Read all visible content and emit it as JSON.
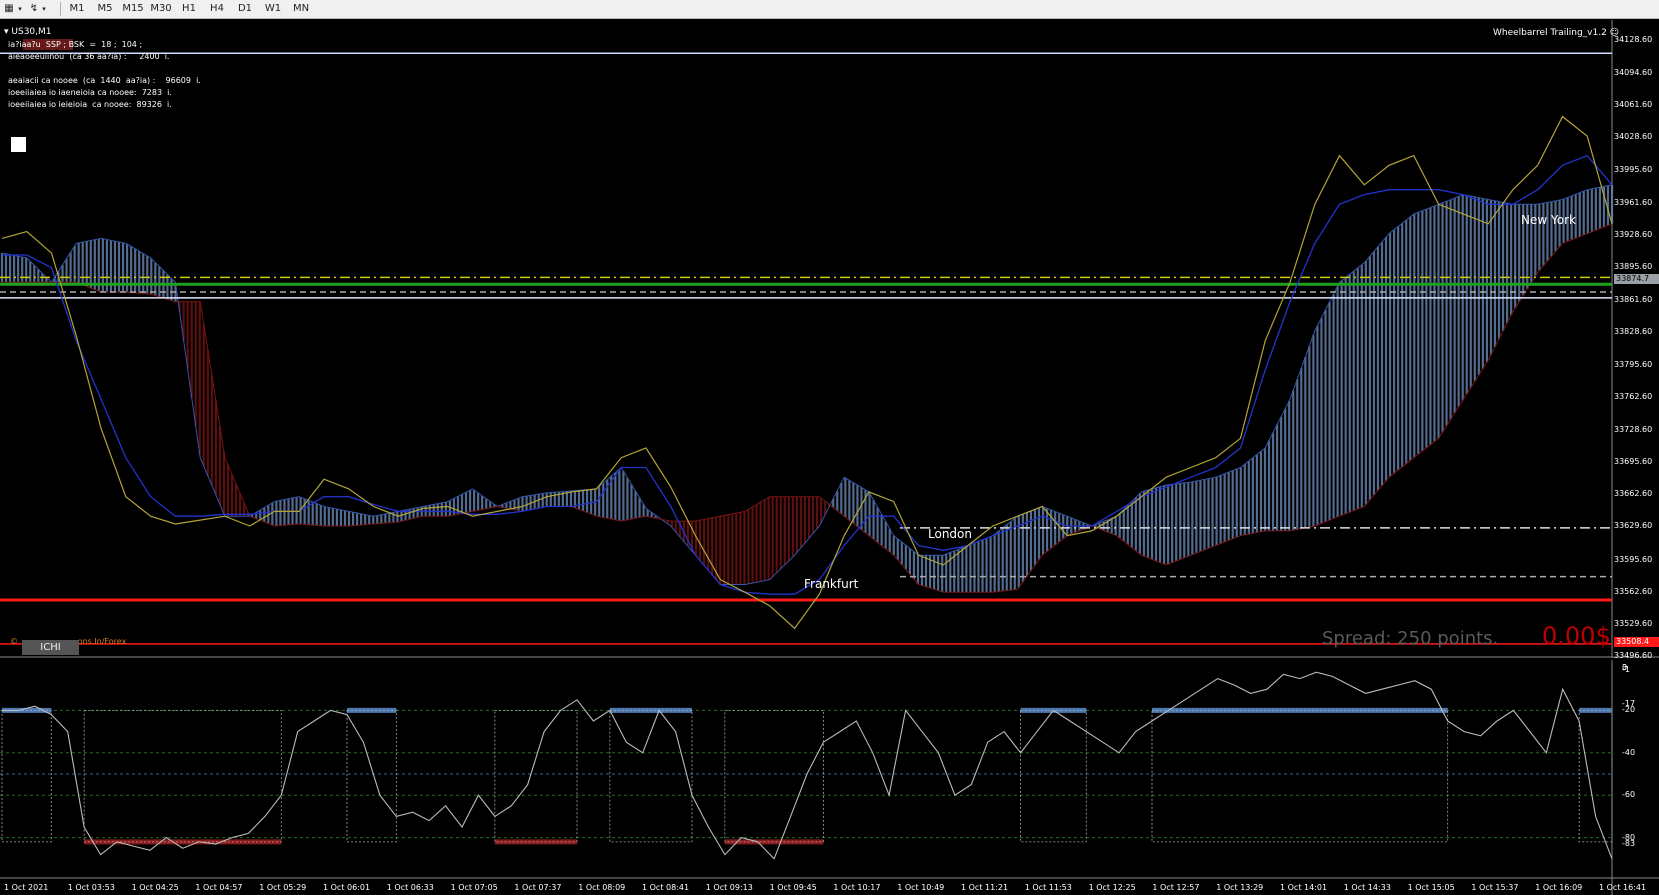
{
  "toolbar": {
    "timeframes": [
      "M1",
      "M5",
      "M15",
      "M30",
      "H1",
      "H4",
      "D1",
      "W1",
      "MN"
    ]
  },
  "chart_header": {
    "symbol": "US30,M1",
    "ea_name": "Wheelbarrel Trailing_v1.2"
  },
  "info_lines": [
    "ia?iaa?u  SSP ; BSK  =  18 ;  104 ;",
    "aieaoeeuiinou  (ca 36 aa?ia) :     2400  i.",
    "aeaiacii ca nooee  (ca  1440  aa?ia) :    96609  i.",
    "ioeeiiaiea io iaeneioia ca nooee:  7283  i.",
    "ioeeiiaiea io ieieioia  ca nooee:  89326  i."
  ],
  "sessions": {
    "new_york": "New York",
    "london": "London",
    "frankfurt": "Frankfurt"
  },
  "spread_text": "Spread: 250 points.",
  "profit_text": "0.00$",
  "ichi_button": "ICHI",
  "copyright_symbol": "©",
  "copyright_text": "...ons.In/Forex",
  "current_price": "33874.7",
  "low_price_tag": "33508.4",
  "colors": {
    "background": "#000000",
    "cloud_bull": "#6f8fbf",
    "cloud_bear": "#7a1414",
    "price_line": "#b2a438",
    "kijun": "#2233cc",
    "support_red": "#ff1a1a",
    "green_level": "#1fa31f",
    "yellow_level": "#cccc00",
    "white_level": "#e0e6ff",
    "osc_bull": "#4d79b3",
    "osc_bear": "#8b1a1a"
  },
  "chart_data": [
    {
      "type": "line",
      "name": "US30,M1 Ichimoku",
      "x": [
        "1 Oct 2021",
        "1 Oct 03:53",
        "1 Oct 04:25",
        "1 Oct 04:57",
        "1 Oct 05:29",
        "1 Oct 06:01",
        "1 Oct 06:33",
        "1 Oct 07:05",
        "1 Oct 07:37",
        "1 Oct 08:09",
        "1 Oct 08:41",
        "1 Oct 09:13",
        "1 Oct 09:45",
        "1 Oct 10:17",
        "1 Oct 10:49",
        "1 Oct 11:21",
        "1 Oct 11:53",
        "1 Oct 12:25",
        "1 Oct 12:57",
        "1 Oct 13:29",
        "1 Oct 14:01",
        "1 Oct 14:33",
        "1 Oct 15:05",
        "1 Oct 15:37",
        "1 Oct 16:09",
        "1 Oct 16:41"
      ],
      "y_ticks": [
        "34128.60",
        "34094.60",
        "34061.60",
        "34028.60",
        "33995.60",
        "33961.60",
        "33928.60",
        "33895.60",
        "33861.60",
        "33828.60",
        "33795.60",
        "33762.60",
        "33728.60",
        "33695.60",
        "33662.60",
        "33629.60",
        "33595.60",
        "33562.60",
        "33529.60",
        "33496.60"
      ],
      "ylim": [
        33496.6,
        34128.6
      ],
      "price": [
        33925,
        33932,
        33910,
        33825,
        33730,
        33660,
        33640,
        33632,
        33636,
        33640,
        33630,
        33645,
        33645,
        33678,
        33668,
        33650,
        33640,
        33648,
        33650,
        33640,
        33645,
        33650,
        33660,
        33665,
        33668,
        33700,
        33710,
        33670,
        33620,
        33575,
        33562,
        33548,
        33525,
        33560,
        33620,
        33665,
        33655,
        33600,
        33590,
        33610,
        33630,
        33640,
        33650,
        33620,
        33625,
        33640,
        33660,
        33680,
        33690,
        33700,
        33720,
        33820,
        33880,
        33960,
        34010,
        33980,
        34000,
        34010,
        33960,
        33950,
        33940,
        33975,
        34000,
        34050,
        34030,
        33940
      ],
      "kijun": [
        33908,
        33908,
        33895,
        33820,
        33760,
        33700,
        33660,
        33640,
        33640,
        33642,
        33642,
        33645,
        33645,
        33660,
        33660,
        33652,
        33645,
        33645,
        33645,
        33642,
        33642,
        33645,
        33650,
        33650,
        33655,
        33690,
        33690,
        33650,
        33600,
        33570,
        33562,
        33560,
        33560,
        33575,
        33610,
        33640,
        33640,
        33610,
        33605,
        33610,
        33620,
        33630,
        33640,
        33630,
        33630,
        33645,
        33660,
        33670,
        33680,
        33690,
        33710,
        33790,
        33860,
        33920,
        33960,
        33970,
        33975,
        33975,
        33975,
        33970,
        33960,
        33960,
        33975,
        34000,
        34010,
        33980
      ],
      "span_a": [
        33910,
        33905,
        33880,
        33920,
        33925,
        33920,
        33905,
        33880,
        33700,
        33640,
        33640,
        33655,
        33660,
        33650,
        33645,
        33640,
        33645,
        33650,
        33655,
        33668,
        33650,
        33660,
        33664,
        33666,
        33668,
        33690,
        33648,
        33630,
        33600,
        33570,
        33570,
        33575,
        33600,
        33630,
        33680,
        33665,
        33620,
        33600,
        33600,
        33610,
        33620,
        33640,
        33650,
        33640,
        33630,
        33640,
        33665,
        33672,
        33675,
        33680,
        33690,
        33710,
        33760,
        33830,
        33880,
        33900,
        33930,
        33950,
        33960,
        33970,
        33965,
        33960,
        33960,
        33965,
        33975,
        33980
      ],
      "span_b": [
        33880,
        33880,
        33880,
        33880,
        33870,
        33870,
        33868,
        33860,
        33860,
        33700,
        33640,
        33630,
        33632,
        33630,
        33630,
        33632,
        33634,
        33640,
        33640,
        33645,
        33650,
        33645,
        33650,
        33650,
        33640,
        33635,
        33640,
        33635,
        33635,
        33640,
        33645,
        33660,
        33660,
        33660,
        33640,
        33620,
        33600,
        33570,
        33562,
        33562,
        33562,
        33565,
        33600,
        33620,
        33630,
        33620,
        33600,
        33590,
        33600,
        33610,
        33620,
        33625,
        33625,
        33630,
        33640,
        33650,
        33680,
        33700,
        33720,
        33760,
        33800,
        33850,
        33890,
        33920,
        33930,
        33940
      ],
      "levels": [
        {
          "name": "yellow-dashdot",
          "value": 33885,
          "color": "#cccc00"
        },
        {
          "name": "green",
          "value": 33878,
          "color": "#1fa31f"
        },
        {
          "name": "gray-dashed",
          "value": 33870,
          "color": "#aaaaaa"
        },
        {
          "name": "light-blue",
          "value": 33864,
          "color": "#e0e6ff"
        },
        {
          "name": "top-blue",
          "value": 34115,
          "color": "#cfe0ff"
        },
        {
          "name": "white-dashdot-right",
          "value": 33628,
          "color": "#dddddd"
        },
        {
          "name": "gray-dashed-right",
          "value": 33578,
          "color": "#aaaaaa"
        },
        {
          "name": "red-support",
          "value": 33554,
          "color": "#ff1a1a"
        },
        {
          "name": "red-thin-bottom",
          "value": 33509,
          "color": "#ff1a1a"
        }
      ]
    },
    {
      "type": "line",
      "name": "Oscillator",
      "y_ticks": [
        "3",
        "-17",
        "-20",
        "-40",
        "0",
        "-60",
        "-80",
        "-83",
        "-1"
      ],
      "ylim": [
        -100,
        0
      ],
      "values": [
        -20,
        -20,
        -18,
        -22,
        -30,
        -75,
        -88,
        -82,
        -84,
        -86,
        -80,
        -85,
        -82,
        -83,
        -80,
        -78,
        -70,
        -60,
        -30,
        -25,
        -20,
        -22,
        -35,
        -60,
        -70,
        -68,
        -72,
        -65,
        -75,
        -60,
        -70,
        -65,
        -55,
        -30,
        -20,
        -15,
        -25,
        -20,
        -35,
        -40,
        -20,
        -30,
        -60,
        -75,
        -88,
        -80,
        -82,
        -90,
        -70,
        -50,
        -35,
        -30,
        -25,
        -40,
        -60,
        -20,
        -30,
        -40,
        -60,
        -55,
        -35,
        -30,
        -40,
        -30,
        -20,
        -25,
        -30,
        -35,
        -40,
        -30,
        -25,
        -20,
        -15,
        -10,
        -5,
        -8,
        -12,
        -10,
        -3,
        -5,
        -2,
        -4,
        -8,
        -12,
        -10,
        -8,
        -6,
        -10,
        -25,
        -30,
        -32,
        -25,
        -20,
        -30,
        -40,
        -10,
        -25,
        -70,
        -90
      ],
      "signal_segments": [
        {
          "from": 0,
          "to": 3,
          "state": "bull"
        },
        {
          "from": 5,
          "to": 17,
          "state": "bear"
        },
        {
          "from": 21,
          "to": 24,
          "state": "bull"
        },
        {
          "from": 30,
          "to": 35,
          "state": "bear"
        },
        {
          "from": 37,
          "to": 42,
          "state": "bull"
        },
        {
          "from": 44,
          "to": 50,
          "state": "bear"
        },
        {
          "from": 62,
          "to": 66,
          "state": "bull"
        },
        {
          "from": 70,
          "to": 88,
          "state": "bull"
        },
        {
          "from": 96,
          "to": 98,
          "state": "bull"
        }
      ]
    }
  ]
}
